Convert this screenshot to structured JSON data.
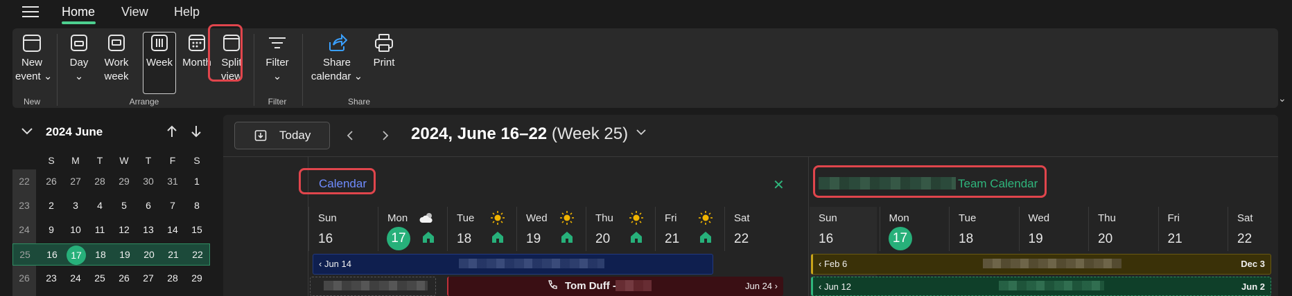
{
  "menu": {
    "home": "Home",
    "view": "View",
    "help": "Help"
  },
  "ribbon": {
    "new_event": [
      "New",
      "event ⌄"
    ],
    "day": [
      "Day",
      "⌄"
    ],
    "work_week": [
      "Work",
      "week"
    ],
    "week": "Week",
    "month": "Month",
    "split_view": [
      "Split",
      "view"
    ],
    "filter": [
      "Filter",
      "⌄"
    ],
    "share_calendar": [
      "Share",
      "calendar ⌄"
    ],
    "print": "Print",
    "groups": {
      "new": "New",
      "arrange": "Arrange",
      "filter": "Filter",
      "share": "Share"
    },
    "selected_view": "Week",
    "highlighted": "Split view"
  },
  "mini_calendar": {
    "title": "2024 June",
    "days_of_week": [
      "S",
      "M",
      "T",
      "W",
      "T",
      "F",
      "S"
    ],
    "rows": [
      {
        "week": "22",
        "days": [
          "26",
          "27",
          "28",
          "29",
          "30",
          "31",
          "1"
        ],
        "muted": [
          true,
          true,
          true,
          true,
          true,
          true,
          false
        ]
      },
      {
        "week": "23",
        "days": [
          "2",
          "3",
          "4",
          "5",
          "6",
          "7",
          "8"
        ]
      },
      {
        "week": "24",
        "days": [
          "9",
          "10",
          "11",
          "12",
          "13",
          "14",
          "15"
        ]
      },
      {
        "week": "25",
        "days": [
          "16",
          "17",
          "18",
          "19",
          "20",
          "21",
          "22"
        ],
        "selected": true,
        "today_index": 1
      },
      {
        "week": "26",
        "days": [
          "23",
          "24",
          "25",
          "26",
          "27",
          "28",
          "29"
        ]
      }
    ]
  },
  "toolbar": {
    "today_label": "Today",
    "range_bold": "2024, June 16–22",
    "range_week": " (Week 25)"
  },
  "left_pane": {
    "calendar_name": "Calendar",
    "days": [
      {
        "name": "Sun",
        "num": "16"
      },
      {
        "name": "Mon",
        "num": "17",
        "today": true,
        "weather": "partly-cloudy",
        "home": true
      },
      {
        "name": "Tue",
        "num": "18",
        "weather": "sunny",
        "home": true
      },
      {
        "name": "Wed",
        "num": "19",
        "weather": "sunny",
        "home": true
      },
      {
        "name": "Thu",
        "num": "20",
        "weather": "sunny",
        "home": true
      },
      {
        "name": "Fri",
        "num": "21",
        "weather": "sunny",
        "home": true
      },
      {
        "name": "Sat",
        "num": "22"
      }
    ],
    "event1_start": "Jun 14",
    "event2_title": "Tom Duff -",
    "event2_end": "Jun 24"
  },
  "right_pane": {
    "calendar_name": "Team Calendar",
    "days": [
      {
        "name": "Sun",
        "num": "16"
      },
      {
        "name": "Mon",
        "num": "17",
        "today": true
      },
      {
        "name": "Tue",
        "num": "18"
      },
      {
        "name": "Wed",
        "num": "19"
      },
      {
        "name": "Thu",
        "num": "20"
      },
      {
        "name": "Fri",
        "num": "21"
      },
      {
        "name": "Sat",
        "num": "22"
      }
    ],
    "event1_start": "Feb 6",
    "event1_end": "Dec 3",
    "event2_start": "Jun 12",
    "event2_end": "Jun 2"
  },
  "colors": {
    "accent_green": "#27b07a",
    "highlight_red": "#e0454c",
    "calendar_blue": "#6f8cff",
    "team_green": "#2fb57c"
  }
}
